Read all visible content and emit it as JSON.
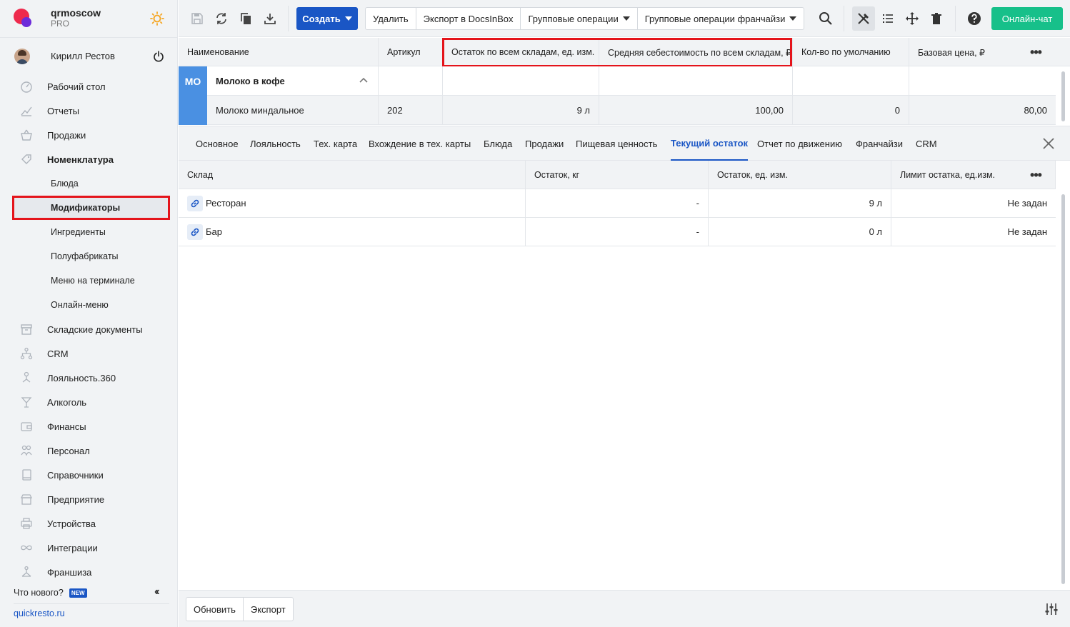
{
  "sidebar": {
    "brand_name": "qrmoscow",
    "brand_plan": "PRO",
    "user_name": "Кирилл Рестов",
    "items": [
      {
        "label": "Рабочий стол",
        "icon": "dashboard-icon"
      },
      {
        "label": "Отчеты",
        "icon": "chart-icon"
      },
      {
        "label": "Продажи",
        "icon": "basket-icon"
      },
      {
        "label": "Номенклатура",
        "icon": "tag-icon"
      }
    ],
    "subitems": [
      "Блюда",
      "Модификаторы",
      "Ингредиенты",
      "Полуфабрикаты",
      "Меню на терминале",
      "Онлайн-меню"
    ],
    "items2": [
      {
        "label": "Складские документы",
        "icon": "archive-icon"
      },
      {
        "label": "CRM",
        "icon": "hierarchy-icon"
      },
      {
        "label": "Лояльность.360",
        "icon": "loyalty-icon"
      },
      {
        "label": "Алкоголь",
        "icon": "glass-icon"
      },
      {
        "label": "Финансы",
        "icon": "wallet-icon"
      },
      {
        "label": "Персонал",
        "icon": "people-icon"
      },
      {
        "label": "Справочники",
        "icon": "book-icon"
      },
      {
        "label": "Предприятие",
        "icon": "store-icon"
      },
      {
        "label": "Устройства",
        "icon": "printer-icon"
      },
      {
        "label": "Интеграции",
        "icon": "infinity-icon"
      },
      {
        "label": "Франшиза",
        "icon": "franchise-icon"
      }
    ],
    "whats_new": "Что нового?",
    "new_badge": "NEW",
    "site_link": "quickresto.ru"
  },
  "toolbar": {
    "create_label": "Создать",
    "delete_label": "Удалить",
    "export_docsinbox": "Экспорт в DocsInBox",
    "group_ops": "Групповые операции",
    "group_ops_franchise": "Групповые операции франчайзи",
    "chat_label": "Онлайн-чат"
  },
  "grid": {
    "columns": [
      "Наименование",
      "Артикул",
      "Остаток по всем складам, ед. изм.",
      "Средняя себестоимость по всем складам, ₽",
      "Кол-во по умолчанию",
      "Базовая цена, ₽"
    ],
    "group_badge": "МО",
    "group_name": "Молоко в кофе",
    "row": {
      "name": "Молоко миндальное",
      "article": "202",
      "stock": "9 л",
      "avg_cost": "100,00",
      "default_qty": "0",
      "base_price": "80,00"
    }
  },
  "tabs": [
    "Основное",
    "Лояльность",
    "Тех. карта",
    "Вхождение в тех. карты",
    "Блюда",
    "Продажи",
    "Пищевая ценность",
    "Текущий остаток",
    "Отчет по движению",
    "Франчайзи",
    "CRM"
  ],
  "active_tab": "Текущий остаток",
  "stock_table": {
    "columns": [
      "Склад",
      "Остаток, кг",
      "Остаток, ед. изм.",
      "Лимит остатка, ед.изм."
    ],
    "rows": [
      {
        "warehouse": "Ресторан",
        "kg": "-",
        "units": "9 л",
        "limit": "Не задан"
      },
      {
        "warehouse": "Бар",
        "kg": "-",
        "units": "0 л",
        "limit": "Не задан"
      }
    ]
  },
  "footer": {
    "refresh_label": "Обновить",
    "export_label": "Экспорт"
  },
  "colors": {
    "accent": "#1a56c5",
    "chat": "#17c08a",
    "highlight": "#e4141b",
    "badge": "#4a90e2"
  }
}
